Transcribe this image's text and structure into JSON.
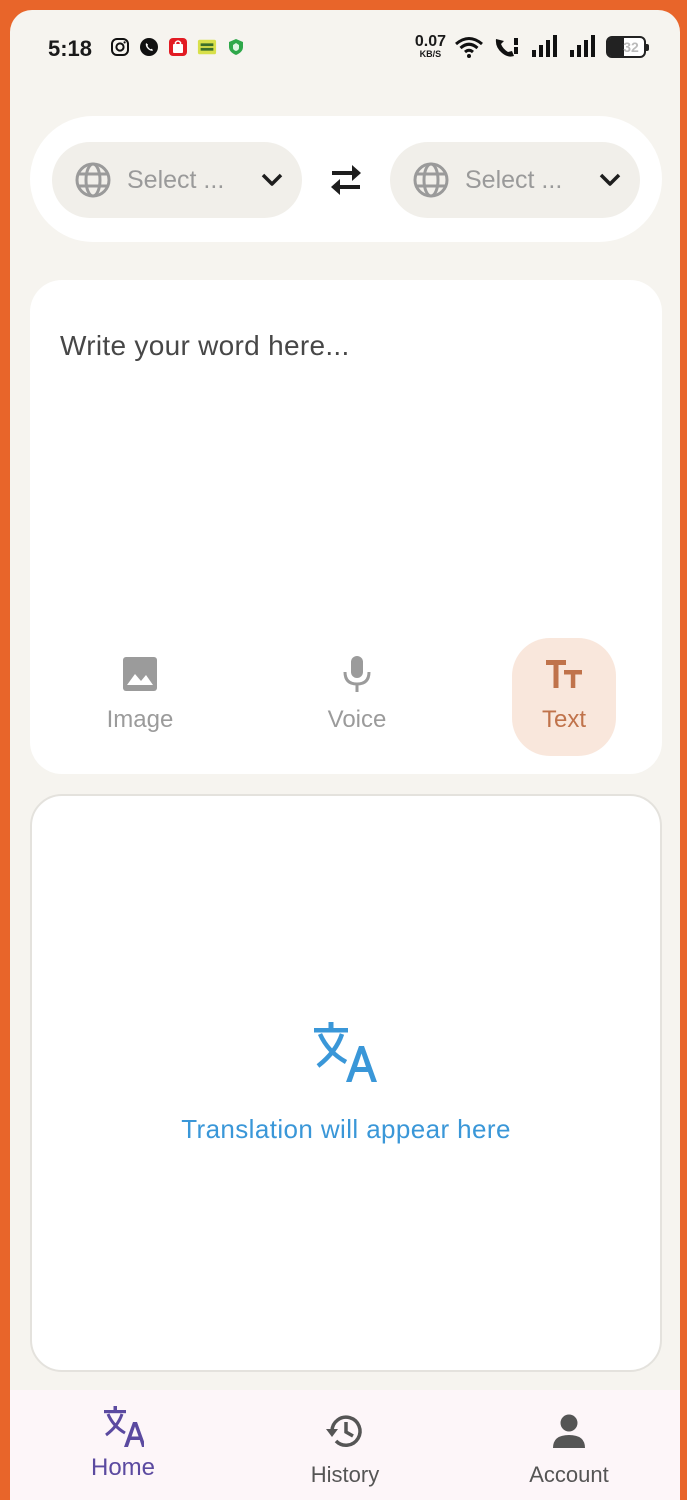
{
  "status_bar": {
    "time": "5:18",
    "net_speed_value": "0.07",
    "net_speed_unit": "KB/S",
    "battery_level": "32",
    "icons": [
      "instagram-icon",
      "whatsapp-icon",
      "shopping-bag-icon",
      "sim-card-icon",
      "shield-icon",
      "wifi-icon",
      "call-icon",
      "signal-icon",
      "signal-icon",
      "battery-icon"
    ]
  },
  "language_selector": {
    "source_label": "Select ...",
    "target_label": "Select ...",
    "icons": [
      "globe-icon",
      "chevron-down-icon",
      "swap-icon"
    ]
  },
  "input": {
    "placeholder": "Write your word here...",
    "modes": [
      {
        "label": "Image",
        "icon": "image-icon",
        "active": false
      },
      {
        "label": "Voice",
        "icon": "mic-icon",
        "active": false
      },
      {
        "label": "Text",
        "icon": "text-fields-icon",
        "active": true
      }
    ]
  },
  "output": {
    "placeholder": "Translation will appear here",
    "icon": "translate-icon"
  },
  "bottom_nav": {
    "items": [
      {
        "label": "Home",
        "icon": "translate-icon",
        "active": true
      },
      {
        "label": "History",
        "icon": "history-icon",
        "active": false
      },
      {
        "label": "Account",
        "icon": "person-icon",
        "active": false
      }
    ]
  },
  "colors": {
    "frame": "#e8652a",
    "background": "#f6f4ef",
    "accent_text_mode": "#c0734b",
    "accent_output": "#3a97d8",
    "nav_active": "#5b4aa0"
  }
}
